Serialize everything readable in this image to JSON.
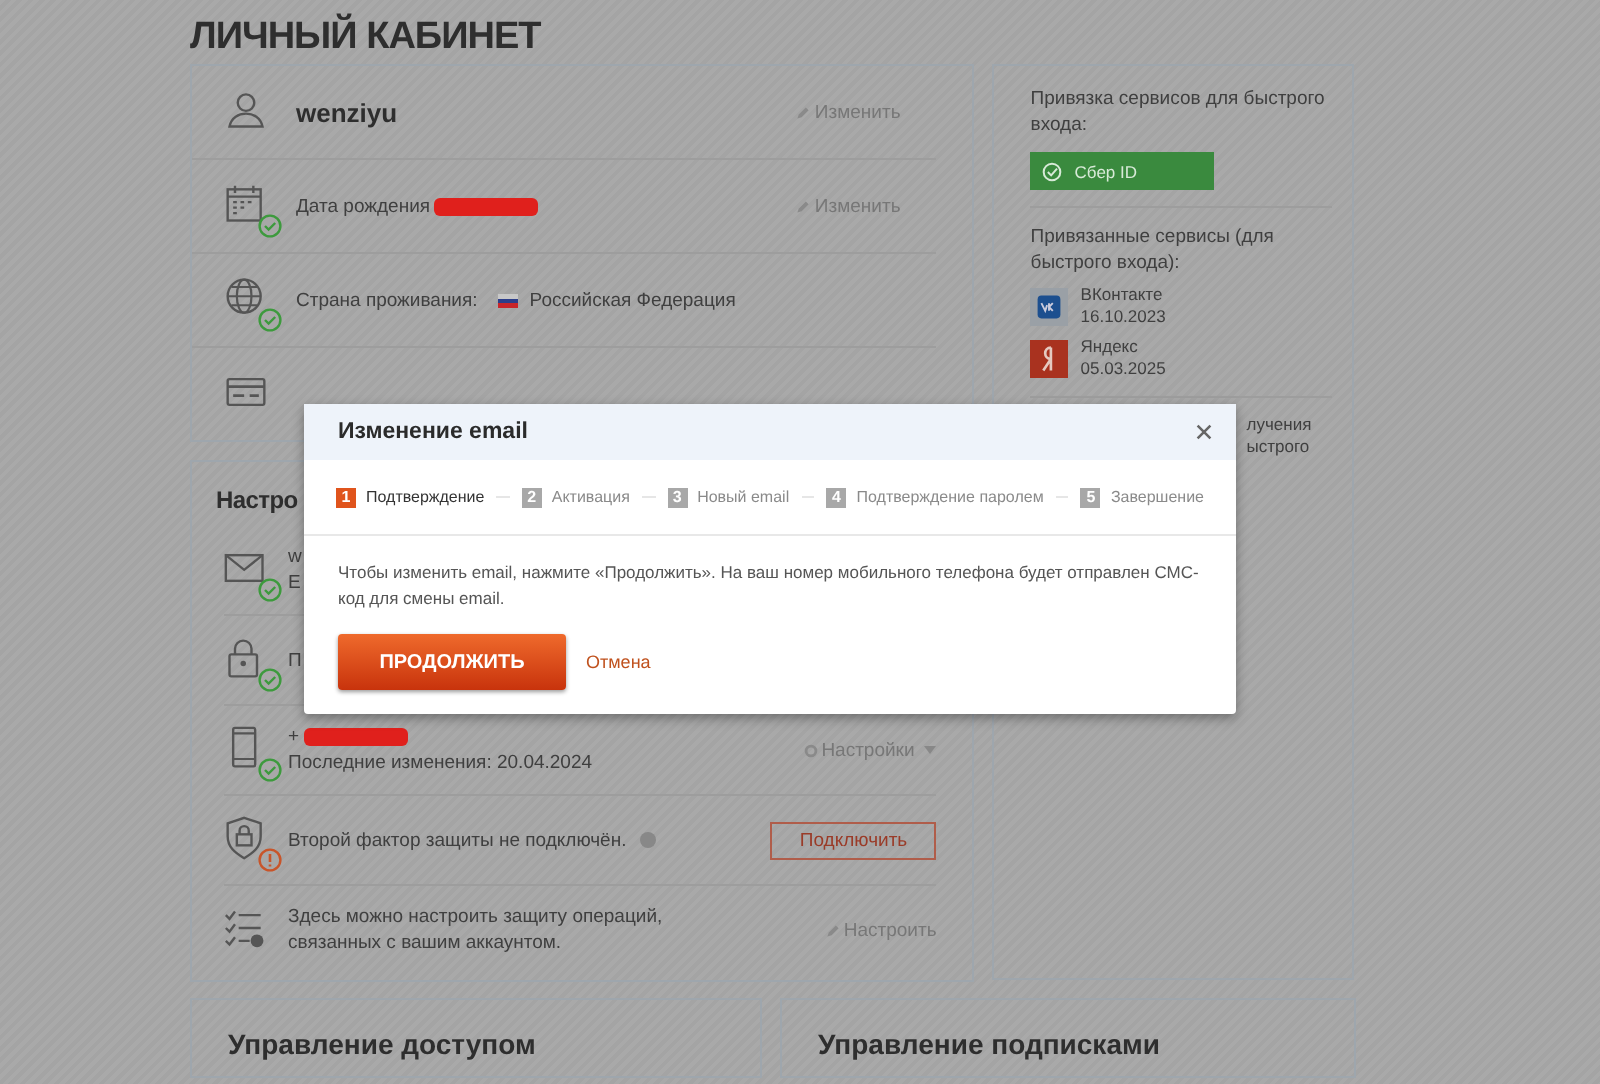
{
  "page_title": "ЛИЧНЫЙ КАБИНЕТ",
  "profile_rows": [
    {
      "kind": "user",
      "text": "wenziyu",
      "action": "Изменить"
    },
    {
      "kind": "calendar",
      "label": "Дата рождения",
      "redacted": true,
      "verified": true,
      "action": "Изменить"
    },
    {
      "kind": "globe",
      "label": "Страна проживания:",
      "value": "Российская Федерация",
      "verified": true
    },
    {
      "kind": "card"
    }
  ],
  "settings": {
    "title": "Настро",
    "rows": [
      {
        "kind": "mail",
        "line1": "w",
        "line2": "Е",
        "verified": true
      },
      {
        "kind": "lock",
        "line1": "П",
        "verified": true
      },
      {
        "kind": "phone",
        "line1": "+",
        "redacted": true,
        "line2": "Последние изменения: 20.04.2024",
        "verified": true,
        "menu": "Настройки"
      },
      {
        "kind": "shield",
        "text": "Второй фактор защиты не подключён.",
        "alert": true,
        "button": "Подключить"
      },
      {
        "kind": "checklist",
        "text": "Здесь можно настроить защиту операций, связанных с вашим аккаунтом.",
        "action": "Настроить"
      }
    ]
  },
  "quick_login": {
    "bind_title": "Привязка сервисов для быстрого входа:",
    "sber_button": "Сбер ID",
    "linked_title": "Привязанные сервисы (для быстрого входа):",
    "services": [
      {
        "kind": "vk",
        "name": "ВКонтакте",
        "date": "16.10.2023"
      },
      {
        "kind": "yandex",
        "name": "Яндекс",
        "date": "05.03.2025"
      }
    ],
    "partial_lines": [
      "лучения",
      "ыстрого"
    ]
  },
  "bottom_cards": [
    "Управление доступом",
    "Управление подписками"
  ],
  "modal": {
    "title": "Изменение email",
    "steps": [
      {
        "number": "1",
        "label": "Подтверждение",
        "selected": true
      },
      {
        "number": "2",
        "label": "Активация",
        "selected": false
      },
      {
        "number": "3",
        "label": "Новый email",
        "selected": false
      },
      {
        "number": "4",
        "label": "Подтверждение паролем",
        "selected": false
      },
      {
        "number": "5",
        "label": "Завершение",
        "selected": false
      }
    ],
    "text": "Чтобы изменить email, нажмите «Продолжить». На ваш номер мобильного телефона будет отправлен СМС-код для смены email.",
    "primary": "ПРОДОЛЖИТЬ",
    "cancel": "Отмена"
  }
}
